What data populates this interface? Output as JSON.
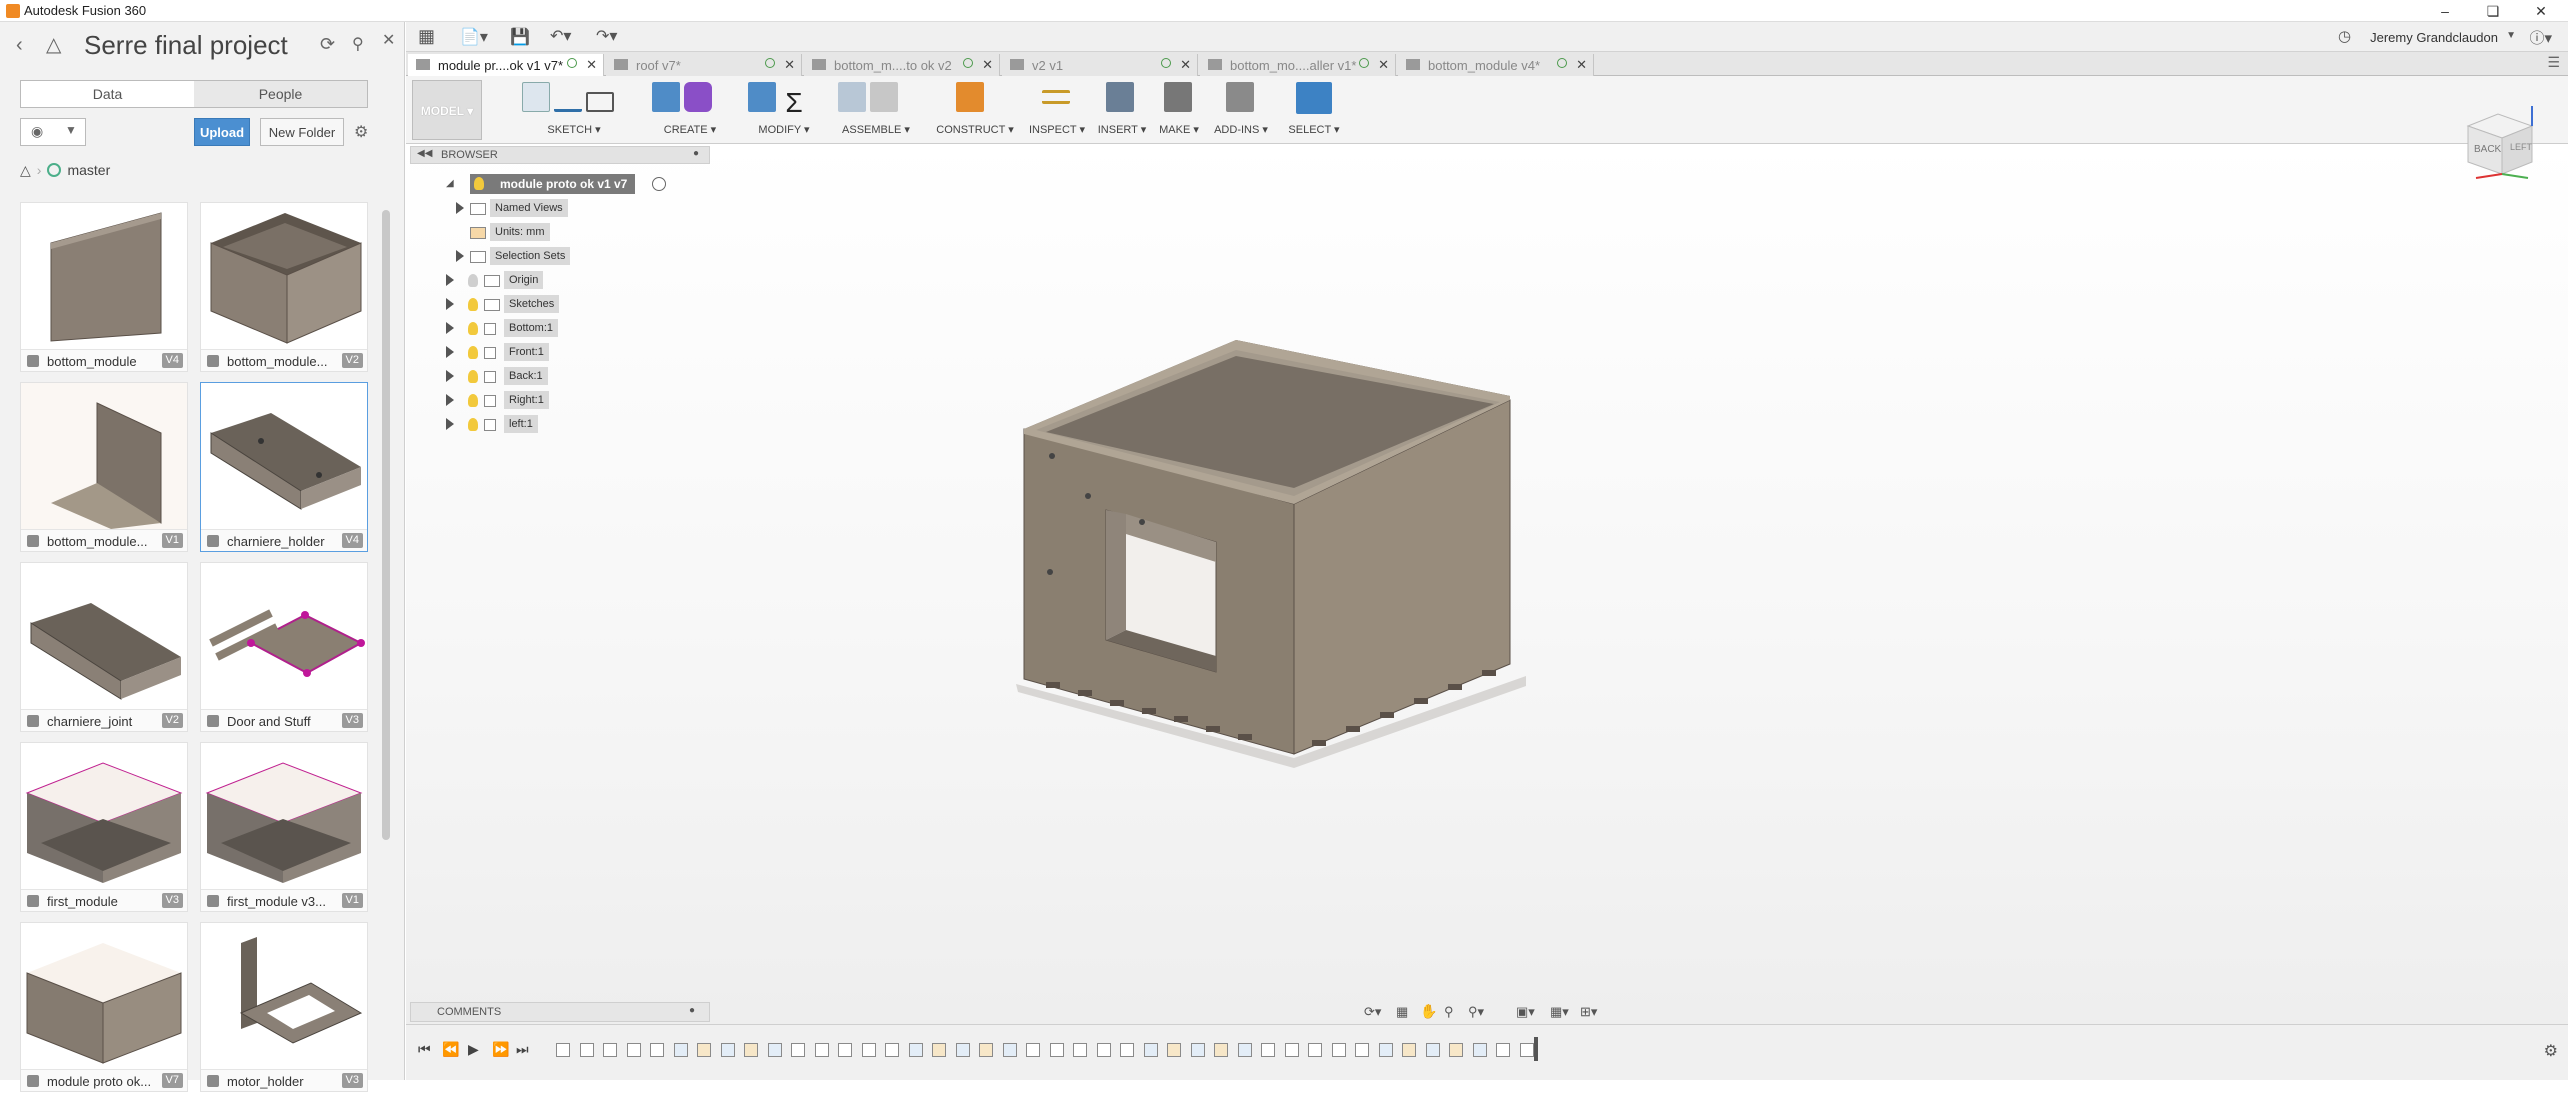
{
  "app": {
    "title": "Autodesk Fusion 360"
  },
  "data_panel": {
    "project_title": "Serre final project",
    "tabs": [
      {
        "label": "Data"
      },
      {
        "label": "People"
      }
    ],
    "upload_label": "Upload",
    "new_folder_label": "New Folder",
    "branch_label": "master",
    "items": [
      {
        "name": "bottom_module",
        "version": "V4"
      },
      {
        "name": "bottom_module...",
        "version": "V2"
      },
      {
        "name": "bottom_module...",
        "version": "V1"
      },
      {
        "name": "charniere_holder",
        "version": "V4"
      },
      {
        "name": "charniere_joint",
        "version": "V2"
      },
      {
        "name": "Door and Stuff",
        "version": "V3"
      },
      {
        "name": "first_module",
        "version": "V3"
      },
      {
        "name": "first_module v3...",
        "version": "V1"
      },
      {
        "name": "module proto ok...",
        "version": "V7"
      },
      {
        "name": "motor_holder",
        "version": "V3"
      }
    ]
  },
  "header": {
    "user_name": "Jeremy Grandclaudon"
  },
  "doc_tabs": [
    {
      "label": "module pr....ok v1 v7*"
    },
    {
      "label": "roof v7*"
    },
    {
      "label": "bottom_m....to ok v2"
    },
    {
      "label": "v2 v1"
    },
    {
      "label": "bottom_mo....aller v1*"
    },
    {
      "label": "bottom_module v4*"
    }
  ],
  "toolbar": {
    "workspace_label": "MODEL",
    "groups": [
      {
        "label": "SKETCH"
      },
      {
        "label": "CREATE"
      },
      {
        "label": "MODIFY"
      },
      {
        "label": "ASSEMBLE"
      },
      {
        "label": "CONSTRUCT"
      },
      {
        "label": "INSPECT"
      },
      {
        "label": "INSERT"
      },
      {
        "label": "MAKE"
      },
      {
        "label": "ADD-INS"
      },
      {
        "label": "SELECT"
      }
    ]
  },
  "browser": {
    "title": "BROWSER",
    "root_label": "module proto ok v1 v7",
    "nodes": [
      {
        "label": "Named Views"
      },
      {
        "label": "Units: mm"
      },
      {
        "label": "Selection Sets"
      },
      {
        "label": "Origin"
      },
      {
        "label": "Sketches"
      },
      {
        "label": "Bottom:1"
      },
      {
        "label": "Front:1"
      },
      {
        "label": "Back:1"
      },
      {
        "label": "Right:1"
      },
      {
        "label": "left:1"
      }
    ]
  },
  "viewcube": {
    "face_label": "BACK",
    "side_label": "LEFT"
  },
  "comments": {
    "label": "COMMENTS"
  }
}
